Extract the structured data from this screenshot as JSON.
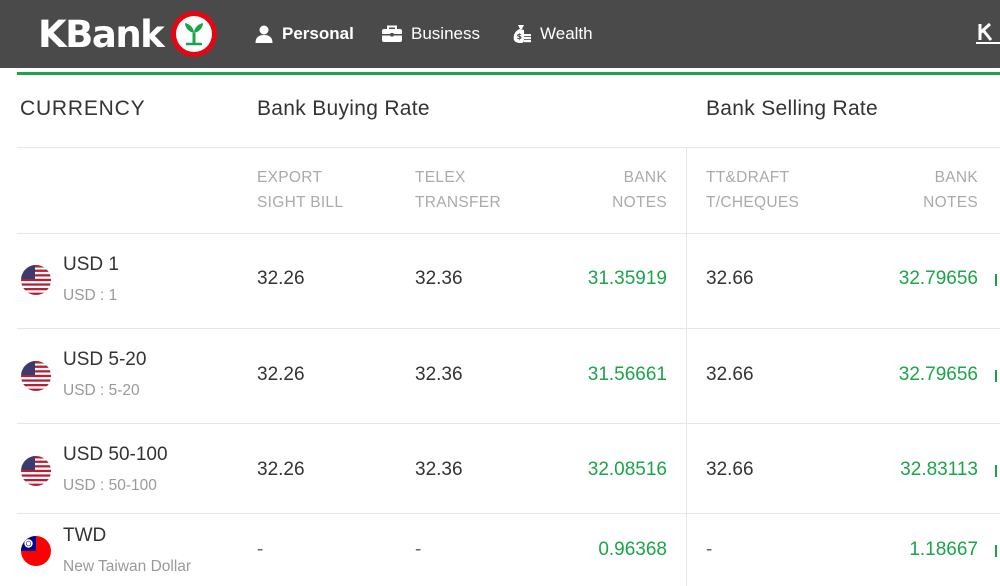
{
  "brand": {
    "name": "KBank"
  },
  "nav": {
    "items": [
      {
        "label": "Personal",
        "icon": "person-icon"
      },
      {
        "label": "Business",
        "icon": "briefcase-icon"
      },
      {
        "label": "Wealth",
        "icon": "money-bag-icon"
      }
    ]
  },
  "colors": {
    "topbar": "#4a4a4a",
    "accent_green": "#1aa54a",
    "logo_red": "#e30613"
  },
  "table": {
    "currency_header": "CURRENCY",
    "buying_header": "Bank Buying Rate",
    "selling_header": "Bank Selling Rate",
    "subheaders": {
      "export_sight_bill": [
        "EXPORT",
        "SIGHT BILL"
      ],
      "telex_transfer": [
        "TELEX",
        "TRANSFER"
      ],
      "buy_bank_notes": [
        "BANK",
        "NOTES"
      ],
      "tt_draft": [
        "TT&DRAFT",
        "T/CHEQUES"
      ],
      "sell_bank_notes": [
        "BANK",
        "NOTES"
      ]
    },
    "rows": [
      {
        "flag": "us-flag-icon",
        "name": "USD 1",
        "sub": "USD : 1",
        "export_sight_bill": "32.26",
        "telex_transfer": "32.36",
        "buy_notes": "31.35919",
        "tt_draft": "32.66",
        "sell_notes": "32.79656"
      },
      {
        "flag": "us-flag-icon",
        "name": "USD 5-20",
        "sub": "USD : 5-20",
        "export_sight_bill": "32.26",
        "telex_transfer": "32.36",
        "buy_notes": "31.56661",
        "tt_draft": "32.66",
        "sell_notes": "32.79656"
      },
      {
        "flag": "us-flag-icon",
        "name": "USD 50-100",
        "sub": "USD : 50-100",
        "export_sight_bill": "32.26",
        "telex_transfer": "32.36",
        "buy_notes": "32.08516",
        "tt_draft": "32.66",
        "sell_notes": "32.83113"
      },
      {
        "flag": "taiwan-flag-icon",
        "name": "TWD",
        "sub": "New Taiwan Dollar",
        "export_sight_bill": "-",
        "telex_transfer": "-",
        "buy_notes": "0.96368",
        "tt_draft": "-",
        "sell_notes": "1.18667"
      }
    ]
  }
}
